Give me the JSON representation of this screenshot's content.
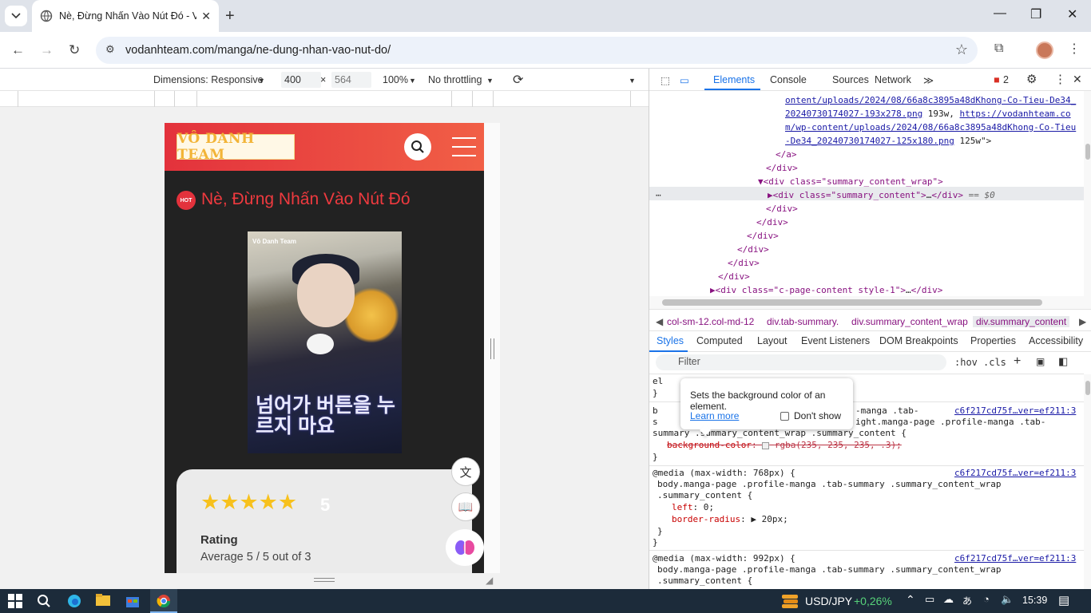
{
  "browser": {
    "tab_title": "Nè, Đừng Nhấn Vào Nút Đó - Vô",
    "url": "vodanhteam.com/manga/ne-dung-nhan-vao-nut-do/"
  },
  "device_toolbar": {
    "dimensions": "Dimensions: Responsive",
    "width": "400",
    "height": "564",
    "zoom": "100%",
    "throttling": "No throttling"
  },
  "page": {
    "logo_text": "VÔ DANH TEAM",
    "hot_badge": "HOT",
    "manga_title": "Nè, Đừng Nhấn Vào Nút Đó",
    "cover_team": "Vô Danh Team",
    "cover_title": "넘어가 버튼을 누르지 마요",
    "stars": "★★★★★",
    "score": "5",
    "rating_label": "Rating",
    "rating_average": "Average 5 / 5 out of 3"
  },
  "devtools": {
    "tabs": [
      "Elements",
      "Console",
      "Sources",
      "Network"
    ],
    "error_count": "2",
    "dom_lines": {
      "l1": "ontent/uploads/2024/08/66a8c3895a48dKhong-Co-Tieu-De34_",
      "l2a": "20240730174027-193x278.png",
      "l2b": " 193w, ",
      "l2c": "https://vodanhteam.co",
      "l3": "m/wp-content/uploads/2024/08/66a8c3895a48dKhong-Co-Tieu",
      "l4a": "-De34_20240730174027-125x180.png",
      "l4b": " 125w\">",
      "l5": "</a>",
      "l6": "</div>",
      "l7": "▼<div class=\"summary_content_wrap\">",
      "l8a": "▶<div class=\"summary_content\">",
      "l8b": "…",
      "l8c": "</div>",
      "l8d": " == $0",
      "l9": "</div>",
      "l10": "</div>",
      "l11": "</div>",
      "l12": "</div>",
      "l13": "</div>",
      "l14": "</div>",
      "l15a": "▶<div class=\"c-page-content style-1\">",
      "l15b": "…",
      "l15c": "</div>"
    },
    "breadcrumbs": [
      "col-sm-12.col-md-12",
      "div.tab-summary.",
      "div.summary_content_wrap",
      "div.summary_content"
    ],
    "sub_tabs": [
      "Styles",
      "Computed",
      "Layout",
      "Event Listeners",
      "DOM Breakpoints",
      "Properties",
      "Accessibility"
    ],
    "filter_placeholder": "Filter",
    "hov": ":hov",
    "cls": ".cls",
    "tooltip": {
      "text": "Sets the background color of an element.",
      "link": "Learn more",
      "checkbox": "Don't show"
    },
    "styles": {
      "r1_sel_a": "el",
      "r1_sel_b": "}",
      "r2_prefix": "b",
      "r2_sel": "-manga .tab-",
      "r2_src": "c6f217cd75f…ver=ef211:3",
      "r3_prefix": "s",
      "r3_sel": "ight.manga-page .profile-manga .tab-",
      "r4": "summary .summary_content_wrap .summary_content {",
      "r5_prop": "background-color",
      "r5_val": "rgba(235, 235, 235, .3);",
      "r6": "}",
      "m1_media": "@media (max-width: 768px) {",
      "m1_src": "c6f217cd75f…ver=ef211:3",
      "m1_sel1": "body.manga-page .profile-manga .tab-summary .summary_content_wrap",
      "m1_sel2": ".summary_content {",
      "m1_p1": "left",
      "m1_v1": "0;",
      "m1_p2": "border-radius",
      "m1_v2": "20px;",
      "m1_close1": "}",
      "m1_close2": "}",
      "m2_media": "@media (max-width: 992px) {",
      "m2_src": "c6f217cd75f…ver=ef211:3",
      "m2_sel1": "body.manga-page .profile-manga .tab-summary .summary_content_wrap",
      "m2_sel2": ".summary_content {"
    }
  },
  "taskbar": {
    "ticker_name": "USD/JPY",
    "ticker_change": "+0,26%",
    "time": "15:39"
  },
  "colors": {
    "header_gradient_start": "#e3323c",
    "header_gradient_end": "#f15f46",
    "title_red": "#ef3a3f",
    "star_gold": "#f7c11d",
    "devtools_blue": "#1a73e8"
  }
}
